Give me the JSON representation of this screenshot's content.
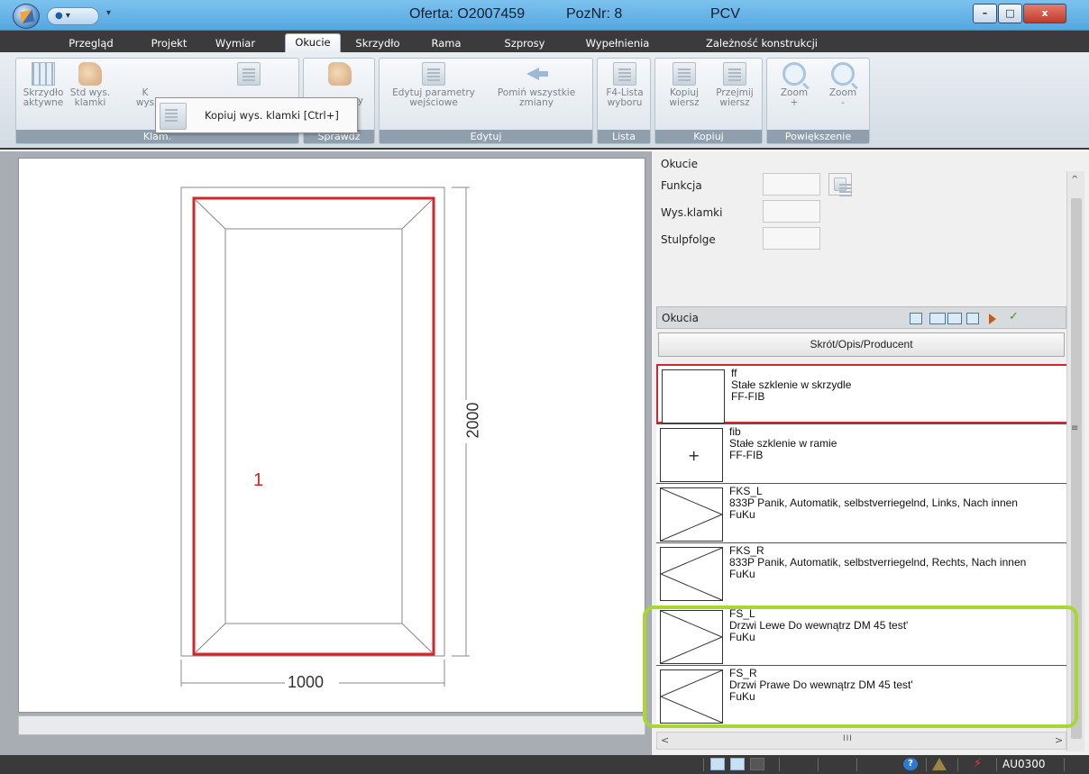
{
  "window": {
    "title_offer": "Oferta: O2007459",
    "title_pos": "PozNr: 8",
    "title_material": "PCV",
    "qa_label": "",
    "min_label": "–",
    "max_label": "□",
    "close_label": "x"
  },
  "tabs": [
    {
      "label": "Przegląd"
    },
    {
      "label": "Projekt"
    },
    {
      "label": "Wymiar"
    },
    {
      "label": "Okucie"
    },
    {
      "label": "Skrzydło"
    },
    {
      "label": "Rama"
    },
    {
      "label": "Szprosy"
    },
    {
      "label": "Wypełnienia"
    },
    {
      "label": "Zależność konstrukcji"
    }
  ],
  "ribbon": {
    "groups": {
      "klam": "Klam.",
      "sprawdz": "Sprawdź",
      "edytuj": "Edytuj",
      "lista": "Lista",
      "kopiuj": "Kopiuj",
      "powiekszenie": "Powiększenie"
    },
    "buttons": {
      "skrzydlo_aktywne": "Skrzydło\naktywne",
      "std_wys_klamki": "Std wys.\nklamki",
      "kopiuj_wys_partial": "K\nwys",
      "sprawdz_partial": "ry",
      "edytuj_parametry": "Edytuj parametry\nwejściowe",
      "pomin_zmiany": "Pomiń wszystkie\nzmiany",
      "f4_lista": "F4-Lista\nwyboru",
      "kopiuj_wiersz": "Kopiuj\nwiersz",
      "przejmij_wiersz": "Przejmij\nwiersz",
      "zoom_in": "Zoom\n+",
      "zoom_out": "Zoom\n-"
    },
    "tooltip": "Kopiuj wys. klamki [Ctrl+]"
  },
  "drawing": {
    "height_label": "2000",
    "width_label": "1000",
    "sash_number": "1"
  },
  "properties": {
    "title": "Okucie",
    "funkcja_label": "Funkcja",
    "wys_klamki_label": "Wys.klamki",
    "stulpfolge_label": "Stulpfolge",
    "funkcja_value": "",
    "wys_klamki_value": "",
    "stulpfolge_value": ""
  },
  "okucia": {
    "header": "Okucia",
    "column": "Skrót/Opis/Producent",
    "items": [
      {
        "code": "ff",
        "desc": "Stałe szklenie w skrzydle",
        "producer": "FF-FIB",
        "thumb": "blank"
      },
      {
        "code": "fib",
        "desc": "Stałe szklenie w ramie",
        "producer": "FF-FIB",
        "thumb": "plus"
      },
      {
        "code": "FKS_L",
        "desc": "833P Panik, Automatik, selbstverriegelnd, Links, Nach innen",
        "producer": "FuKu",
        "thumb": "tri-right"
      },
      {
        "code": "FKS_R",
        "desc": "833P Panik, Automatik, selbstverriegelnd, Rechts, Nach innen",
        "producer": "FuKu",
        "thumb": "tri-left"
      },
      {
        "code": "FS_L",
        "desc": "Drzwi Lewe Do wewnątrz DM 45 test'",
        "producer": "FuKu",
        "thumb": "tri-right"
      },
      {
        "code": "FS_R",
        "desc": "Drzwi Prawe Do wewnątrz DM 45 test'",
        "producer": "FuKu",
        "thumb": "tri-left"
      }
    ],
    "plus_glyph": "+"
  },
  "scroll": {
    "grip": "III"
  },
  "status": {
    "code": "AU0300"
  },
  "colors": {
    "accent_red": "#d2262a",
    "highlight_green": "#a9d630",
    "tab_bar": "#3b3b3b",
    "titlebar": "#6bb6ea"
  }
}
